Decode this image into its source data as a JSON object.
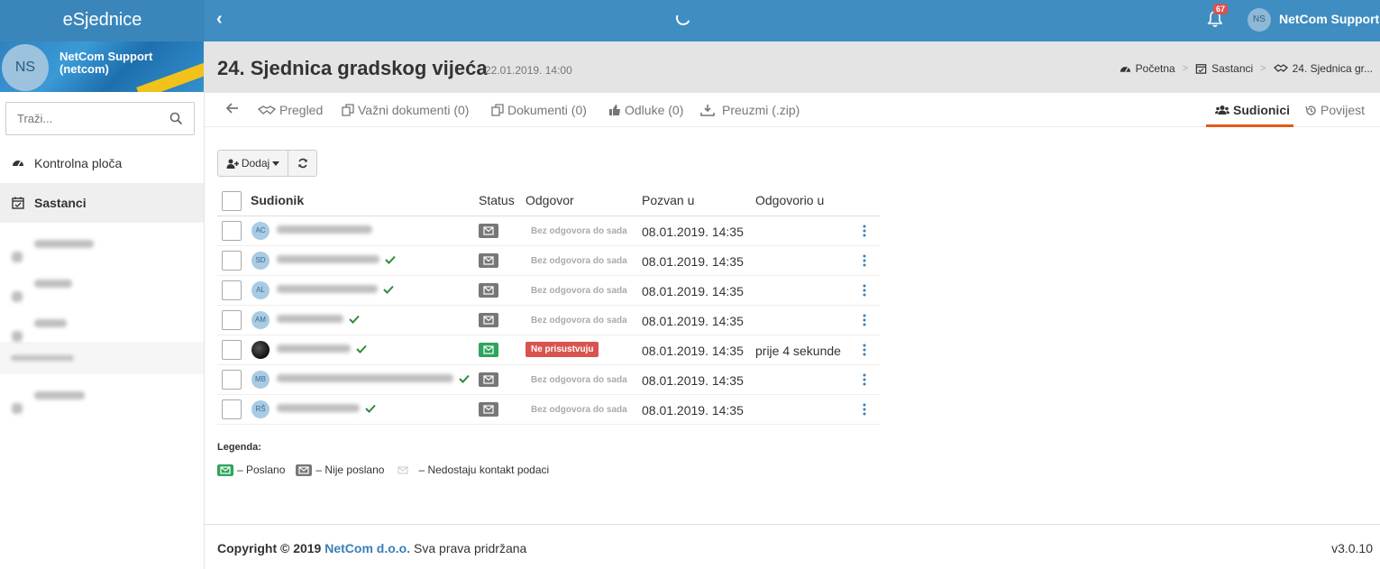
{
  "app": {
    "brand": "eSjednice",
    "notification_count": "67",
    "user_initials": "NS",
    "user_name": "NetCom Support"
  },
  "sidebar": {
    "profile_initials": "NS",
    "profile_name": "NetCom Support (netcom)",
    "search_placeholder": "Traži...",
    "items": [
      {
        "label": "Kontrolna ploča",
        "icon": "dashboard-icon"
      },
      {
        "label": "Sastanci",
        "icon": "calendar-check-icon"
      }
    ]
  },
  "header": {
    "title": "24. Sjednica gradskog vijeća",
    "date": "22.01.2019. 14:00",
    "breadcrumb": [
      "Početna",
      "Sastanci",
      "24. Sjednica gr..."
    ]
  },
  "tabs": {
    "pregled": "Pregled",
    "vazni": "Važni dokumenti (0)",
    "dokumenti": "Dokumenti (0)",
    "odluke": "Odluke (0)",
    "preuzmi": "Preuzmi (.zip)",
    "sudionici": "Sudionici",
    "povijest": "Povijest"
  },
  "toolbar": {
    "add_label": "Dodaj"
  },
  "table": {
    "headers": [
      "Sudionik",
      "Status",
      "Odgovor",
      "Pozvan u",
      "Odgovorio u"
    ],
    "rows": [
      {
        "initials": "AC",
        "status": "not-sent",
        "answer": "Bez odgovora do sada",
        "invited": "08.01.2019. 14:35",
        "responded": "",
        "confirmed": false
      },
      {
        "initials": "SD",
        "status": "not-sent",
        "answer": "Bez odgovora do sada",
        "invited": "08.01.2019. 14:35",
        "responded": "",
        "confirmed": true
      },
      {
        "initials": "AL",
        "status": "not-sent",
        "answer": "Bez odgovora do sada",
        "invited": "08.01.2019. 14:35",
        "responded": "",
        "confirmed": true
      },
      {
        "initials": "AM",
        "status": "not-sent",
        "answer": "Bez odgovora do sada",
        "invited": "08.01.2019. 14:35",
        "responded": "",
        "confirmed": true
      },
      {
        "initials": "",
        "status": "sent",
        "answer": "Ne prisustvuju",
        "invited": "08.01.2019. 14:35",
        "responded": "prije 4 sekunde",
        "confirmed": true
      },
      {
        "initials": "MB",
        "status": "not-sent",
        "answer": "Bez odgovora do sada",
        "invited": "08.01.2019. 14:35",
        "responded": "",
        "confirmed": true
      },
      {
        "initials": "RŠ",
        "status": "not-sent",
        "answer": "Bez odgovora do sada",
        "invited": "08.01.2019. 14:35",
        "responded": "",
        "confirmed": true
      }
    ]
  },
  "legend": {
    "title": "Legenda:",
    "sent": "– Poslano",
    "not_sent": "– Nije poslano",
    "missing": "– Nedostaju kontakt podaci"
  },
  "footer": {
    "copyright_prefix": "Copyright © 2019",
    "company": "NetCom d.o.o.",
    "rights": "Sva prava pridržana",
    "version": "v3.0.10"
  },
  "colors": {
    "topbar": "#3f8dc1",
    "accent_tab": "#e05a1a",
    "sent": "#2ea55c",
    "not_sent": "#777777",
    "declined": "#d9534f",
    "link": "#3a7fb6"
  }
}
